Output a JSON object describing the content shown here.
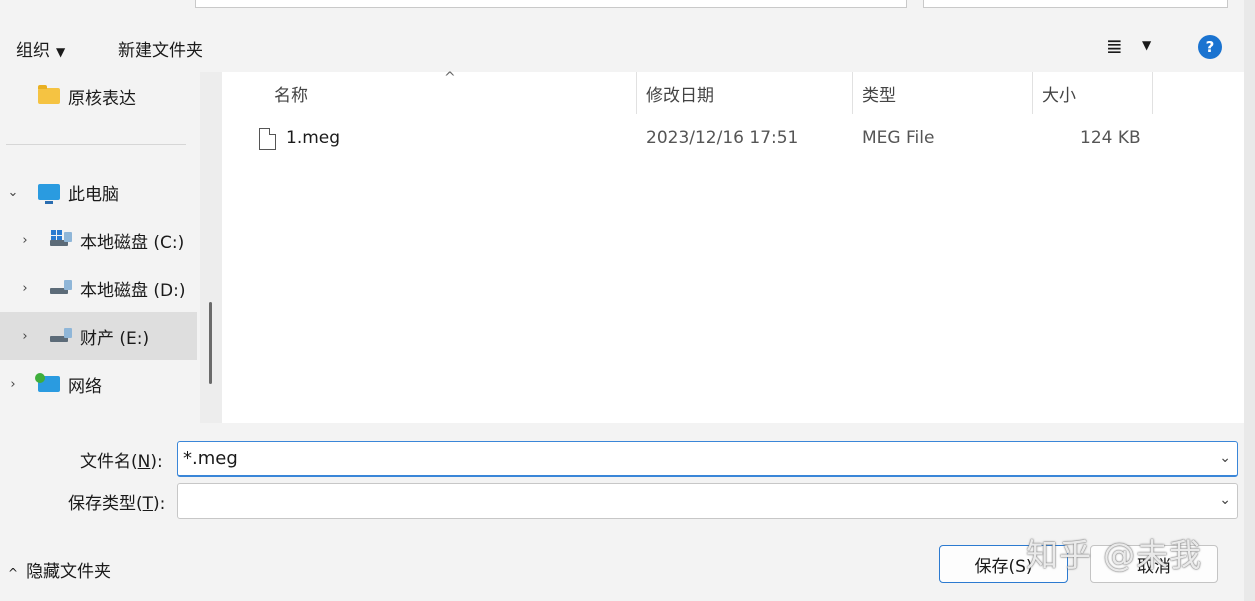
{
  "toolbar": {
    "organize_label": "组织",
    "new_folder_label": "新建文件夹",
    "view_icon": "list-view-icon",
    "help_label": "?"
  },
  "sidebar": {
    "items": [
      {
        "label": "原核表达",
        "icon": "folder-icon"
      },
      {
        "label": "此电脑",
        "icon": "pc-icon"
      },
      {
        "label": "本地磁盘 (C:)",
        "icon": "drive-c-icon"
      },
      {
        "label": "本地磁盘 (D:)",
        "icon": "drive-icon"
      },
      {
        "label": "财产 (E:)",
        "icon": "drive-icon",
        "selected": true
      },
      {
        "label": "网络",
        "icon": "network-icon"
      }
    ]
  },
  "files": {
    "columns": [
      "名称",
      "修改日期",
      "类型",
      "大小"
    ],
    "rows": [
      {
        "name": "1.meg",
        "modified": "2023/12/16 17:51",
        "type": "MEG File",
        "size": "124 KB"
      }
    ]
  },
  "form": {
    "filename_label": "文件名(N):",
    "filename_mnemonic": "N",
    "filename_value": "*.meg",
    "filetype_label": "保存类型(T):",
    "filetype_mnemonic": "T",
    "filetype_value": ""
  },
  "footer": {
    "hide_folders_label": "隐藏文件夹",
    "save_label": "保存(S)",
    "cancel_label": "取消"
  },
  "watermark": "知乎 @未我",
  "colors": {
    "accent": "#3a86d8",
    "help": "#1a73d0",
    "selected_bg": "#dedede"
  }
}
